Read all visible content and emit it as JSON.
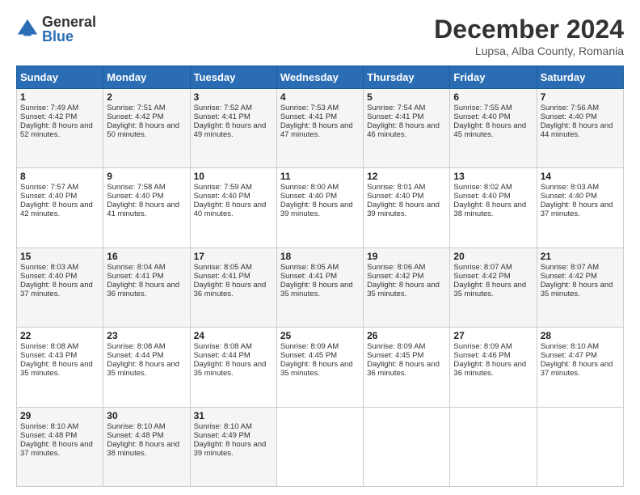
{
  "logo": {
    "general": "General",
    "blue": "Blue"
  },
  "header": {
    "month": "December 2024",
    "location": "Lupsa, Alba County, Romania"
  },
  "weekdays": [
    "Sunday",
    "Monday",
    "Tuesday",
    "Wednesday",
    "Thursday",
    "Friday",
    "Saturday"
  ],
  "weeks": [
    [
      {
        "day": "1",
        "sunrise": "Sunrise: 7:49 AM",
        "sunset": "Sunset: 4:42 PM",
        "daylight": "Daylight: 8 hours and 52 minutes."
      },
      {
        "day": "2",
        "sunrise": "Sunrise: 7:51 AM",
        "sunset": "Sunset: 4:42 PM",
        "daylight": "Daylight: 8 hours and 50 minutes."
      },
      {
        "day": "3",
        "sunrise": "Sunrise: 7:52 AM",
        "sunset": "Sunset: 4:41 PM",
        "daylight": "Daylight: 8 hours and 49 minutes."
      },
      {
        "day": "4",
        "sunrise": "Sunrise: 7:53 AM",
        "sunset": "Sunset: 4:41 PM",
        "daylight": "Daylight: 8 hours and 47 minutes."
      },
      {
        "day": "5",
        "sunrise": "Sunrise: 7:54 AM",
        "sunset": "Sunset: 4:41 PM",
        "daylight": "Daylight: 8 hours and 46 minutes."
      },
      {
        "day": "6",
        "sunrise": "Sunrise: 7:55 AM",
        "sunset": "Sunset: 4:40 PM",
        "daylight": "Daylight: 8 hours and 45 minutes."
      },
      {
        "day": "7",
        "sunrise": "Sunrise: 7:56 AM",
        "sunset": "Sunset: 4:40 PM",
        "daylight": "Daylight: 8 hours and 44 minutes."
      }
    ],
    [
      {
        "day": "8",
        "sunrise": "Sunrise: 7:57 AM",
        "sunset": "Sunset: 4:40 PM",
        "daylight": "Daylight: 8 hours and 42 minutes."
      },
      {
        "day": "9",
        "sunrise": "Sunrise: 7:58 AM",
        "sunset": "Sunset: 4:40 PM",
        "daylight": "Daylight: 8 hours and 41 minutes."
      },
      {
        "day": "10",
        "sunrise": "Sunrise: 7:59 AM",
        "sunset": "Sunset: 4:40 PM",
        "daylight": "Daylight: 8 hours and 40 minutes."
      },
      {
        "day": "11",
        "sunrise": "Sunrise: 8:00 AM",
        "sunset": "Sunset: 4:40 PM",
        "daylight": "Daylight: 8 hours and 39 minutes."
      },
      {
        "day": "12",
        "sunrise": "Sunrise: 8:01 AM",
        "sunset": "Sunset: 4:40 PM",
        "daylight": "Daylight: 8 hours and 39 minutes."
      },
      {
        "day": "13",
        "sunrise": "Sunrise: 8:02 AM",
        "sunset": "Sunset: 4:40 PM",
        "daylight": "Daylight: 8 hours and 38 minutes."
      },
      {
        "day": "14",
        "sunrise": "Sunrise: 8:03 AM",
        "sunset": "Sunset: 4:40 PM",
        "daylight": "Daylight: 8 hours and 37 minutes."
      }
    ],
    [
      {
        "day": "15",
        "sunrise": "Sunrise: 8:03 AM",
        "sunset": "Sunset: 4:40 PM",
        "daylight": "Daylight: 8 hours and 37 minutes."
      },
      {
        "day": "16",
        "sunrise": "Sunrise: 8:04 AM",
        "sunset": "Sunset: 4:41 PM",
        "daylight": "Daylight: 8 hours and 36 minutes."
      },
      {
        "day": "17",
        "sunrise": "Sunrise: 8:05 AM",
        "sunset": "Sunset: 4:41 PM",
        "daylight": "Daylight: 8 hours and 36 minutes."
      },
      {
        "day": "18",
        "sunrise": "Sunrise: 8:05 AM",
        "sunset": "Sunset: 4:41 PM",
        "daylight": "Daylight: 8 hours and 35 minutes."
      },
      {
        "day": "19",
        "sunrise": "Sunrise: 8:06 AM",
        "sunset": "Sunset: 4:42 PM",
        "daylight": "Daylight: 8 hours and 35 minutes."
      },
      {
        "day": "20",
        "sunrise": "Sunrise: 8:07 AM",
        "sunset": "Sunset: 4:42 PM",
        "daylight": "Daylight: 8 hours and 35 minutes."
      },
      {
        "day": "21",
        "sunrise": "Sunrise: 8:07 AM",
        "sunset": "Sunset: 4:42 PM",
        "daylight": "Daylight: 8 hours and 35 minutes."
      }
    ],
    [
      {
        "day": "22",
        "sunrise": "Sunrise: 8:08 AM",
        "sunset": "Sunset: 4:43 PM",
        "daylight": "Daylight: 8 hours and 35 minutes."
      },
      {
        "day": "23",
        "sunrise": "Sunrise: 8:08 AM",
        "sunset": "Sunset: 4:44 PM",
        "daylight": "Daylight: 8 hours and 35 minutes."
      },
      {
        "day": "24",
        "sunrise": "Sunrise: 8:08 AM",
        "sunset": "Sunset: 4:44 PM",
        "daylight": "Daylight: 8 hours and 35 minutes."
      },
      {
        "day": "25",
        "sunrise": "Sunrise: 8:09 AM",
        "sunset": "Sunset: 4:45 PM",
        "daylight": "Daylight: 8 hours and 35 minutes."
      },
      {
        "day": "26",
        "sunrise": "Sunrise: 8:09 AM",
        "sunset": "Sunset: 4:45 PM",
        "daylight": "Daylight: 8 hours and 36 minutes."
      },
      {
        "day": "27",
        "sunrise": "Sunrise: 8:09 AM",
        "sunset": "Sunset: 4:46 PM",
        "daylight": "Daylight: 8 hours and 36 minutes."
      },
      {
        "day": "28",
        "sunrise": "Sunrise: 8:10 AM",
        "sunset": "Sunset: 4:47 PM",
        "daylight": "Daylight: 8 hours and 37 minutes."
      }
    ],
    [
      {
        "day": "29",
        "sunrise": "Sunrise: 8:10 AM",
        "sunset": "Sunset: 4:48 PM",
        "daylight": "Daylight: 8 hours and 37 minutes."
      },
      {
        "day": "30",
        "sunrise": "Sunrise: 8:10 AM",
        "sunset": "Sunset: 4:48 PM",
        "daylight": "Daylight: 8 hours and 38 minutes."
      },
      {
        "day": "31",
        "sunrise": "Sunrise: 8:10 AM",
        "sunset": "Sunset: 4:49 PM",
        "daylight": "Daylight: 8 hours and 39 minutes."
      },
      null,
      null,
      null,
      null
    ]
  ]
}
